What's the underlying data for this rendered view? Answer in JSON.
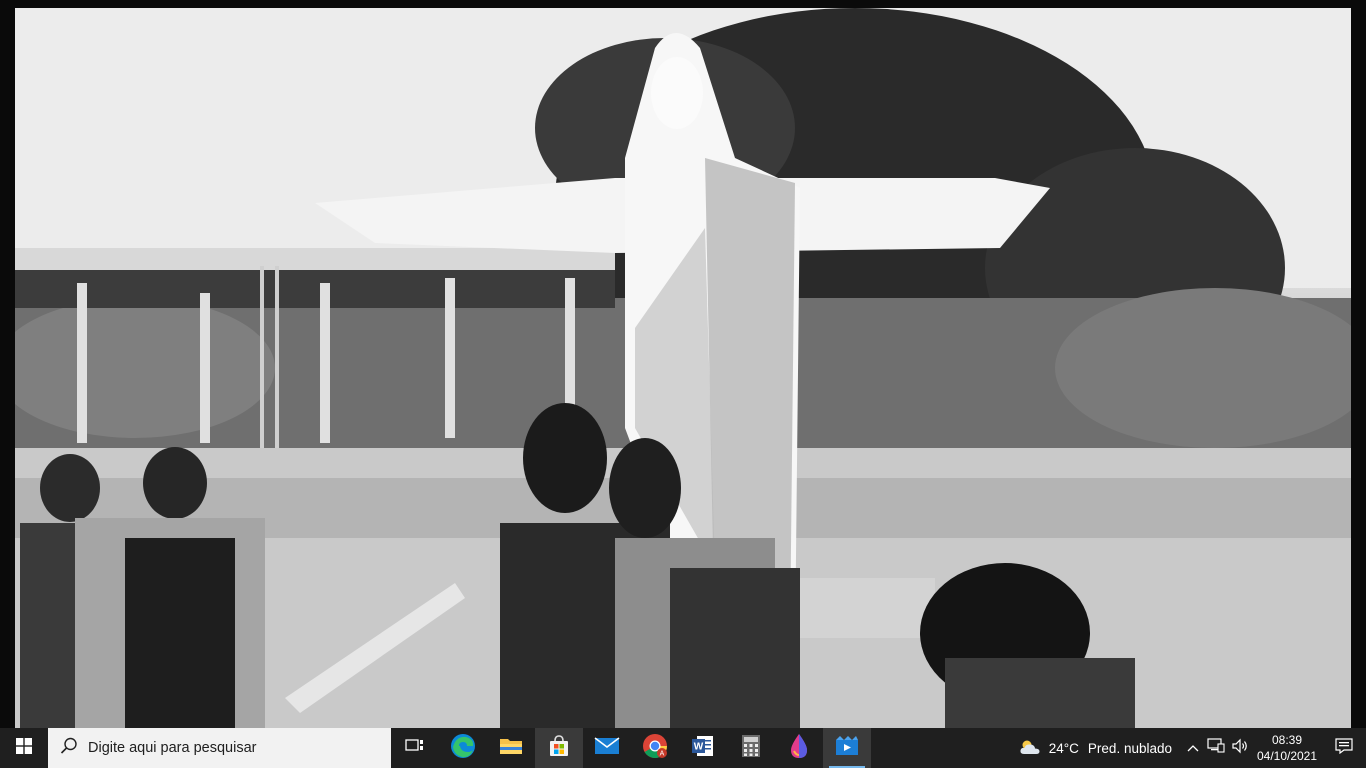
{
  "taskbar": {
    "search_placeholder": "Digite aqui para pesquisar",
    "apps": [
      {
        "name": "task-view",
        "label": "Visão de Tarefas"
      },
      {
        "name": "edge",
        "label": "Microsoft Edge"
      },
      {
        "name": "file-explorer",
        "label": "Explorador de Arquivos"
      },
      {
        "name": "store",
        "label": "Microsoft Store"
      },
      {
        "name": "mail",
        "label": "Email"
      },
      {
        "name": "chrome",
        "label": "Google Chrome"
      },
      {
        "name": "word",
        "label": "Word"
      },
      {
        "name": "calculator",
        "label": "Calculadora"
      },
      {
        "name": "paint3d",
        "label": "Paint 3D"
      },
      {
        "name": "video-player",
        "label": "Filmes e TV"
      }
    ],
    "weather": {
      "temp": "24°C",
      "desc": "Pred. nublado"
    },
    "clock": {
      "time": "08:39",
      "date": "04/10/2021"
    },
    "colors": {
      "taskbar_bg": "#1f1f1f",
      "accent": "#76b9ed",
      "search_bg": "#f2f2f2"
    }
  }
}
